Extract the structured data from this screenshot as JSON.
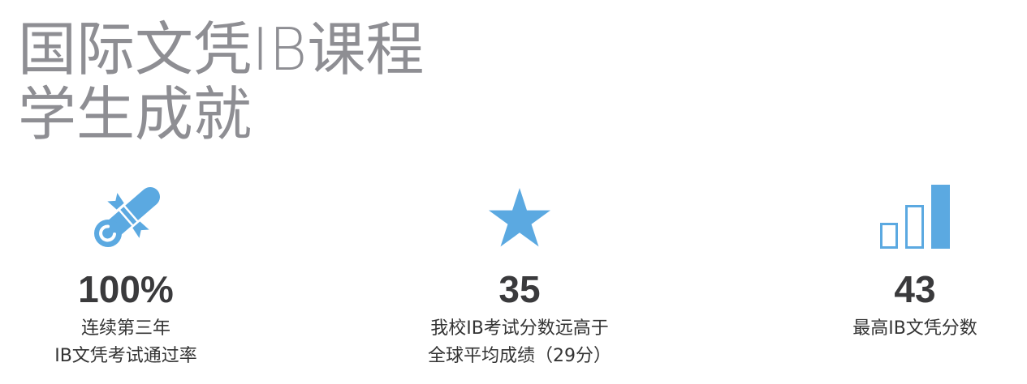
{
  "title": {
    "line1": "国际文凭IB课程",
    "line2": "学生成就"
  },
  "colors": {
    "accent": "#5ba9e1",
    "title": "#8e8e93",
    "number": "#3a3a3c",
    "text": "#333333"
  },
  "stats": [
    {
      "icon": "diploma-icon",
      "value": "100%",
      "lines": [
        "连续第三年",
        "IB文凭考试通过率"
      ]
    },
    {
      "icon": "star-icon",
      "value": "35",
      "lines": [
        "我校IB考试分数远高于",
        "全球平均成绩（29分）"
      ]
    },
    {
      "icon": "bar-chart-icon",
      "value": "43",
      "lines": [
        "最高IB文凭分数"
      ]
    }
  ]
}
